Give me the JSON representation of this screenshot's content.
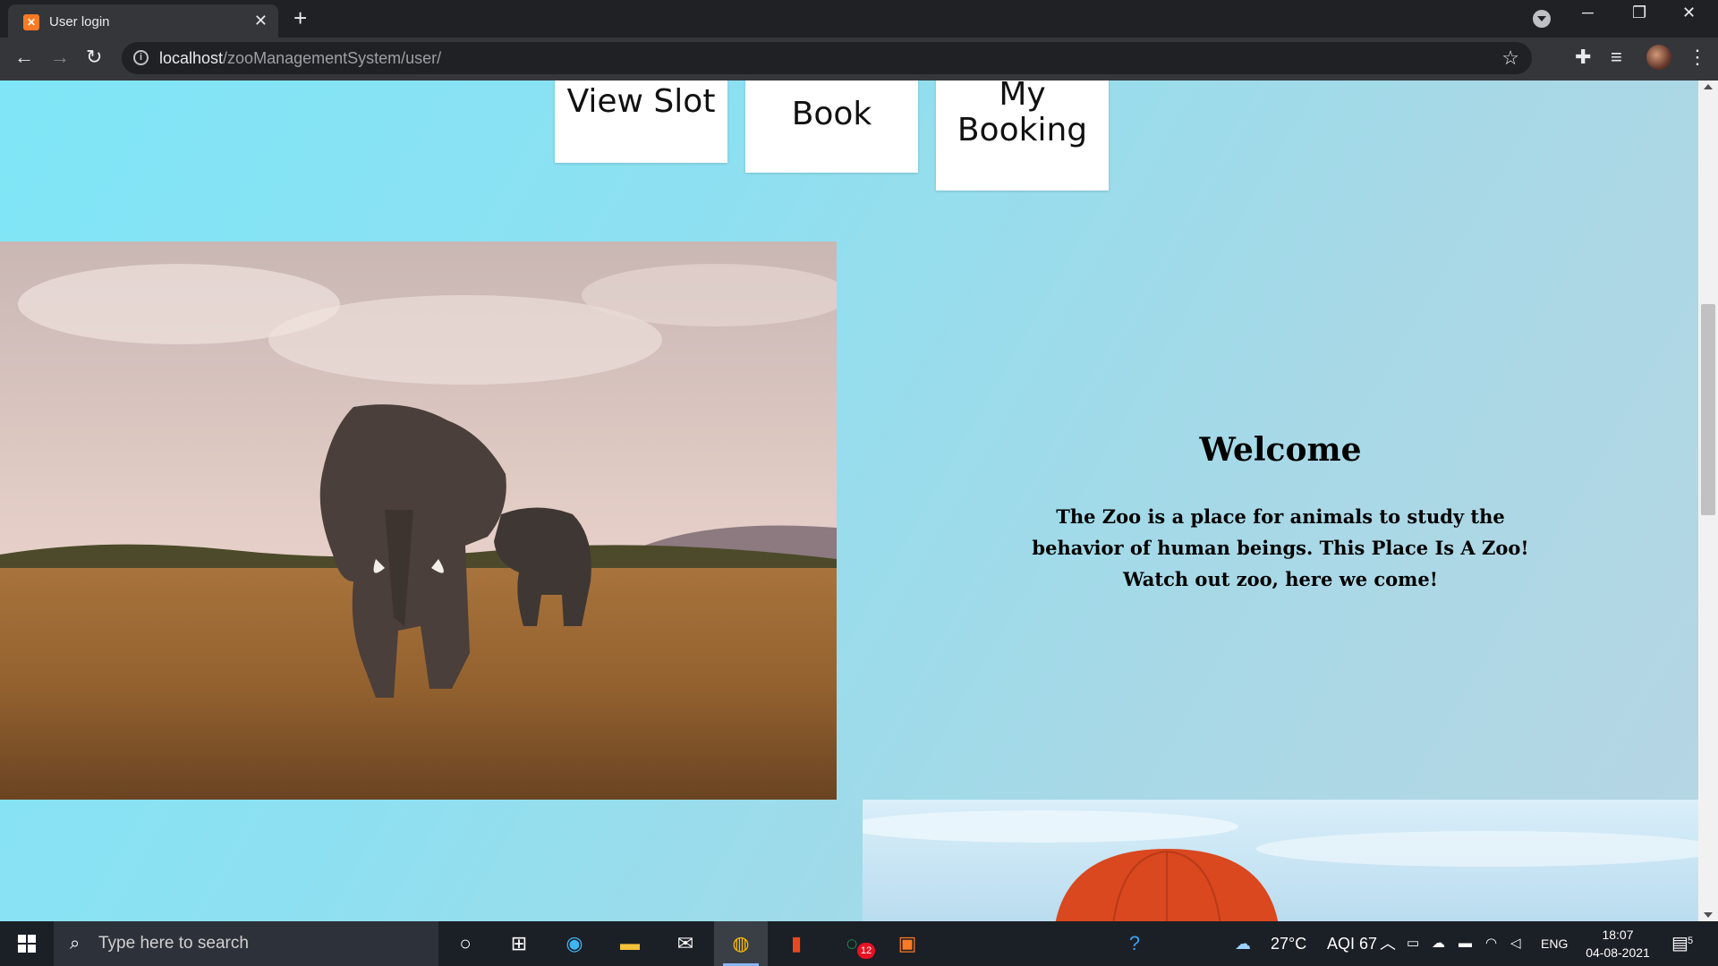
{
  "browser": {
    "tab_title": "User login",
    "tab_favicon_icon": "xampp-icon",
    "url_host": "localhost",
    "url_path": "/zooManagementSystem/user/"
  },
  "nav": {
    "view_slot": "View Slot",
    "book": "Book",
    "my_booking_line1": "My",
    "my_booking_line2": "Booking"
  },
  "welcome": {
    "title": "Welcome",
    "text": "The Zoo is a place for animals to study the behavior of human beings. This Place Is A Zoo! Watch out zoo, here we come!"
  },
  "taskbar": {
    "search_placeholder": "Type here to search",
    "whatsapp_badge": "12",
    "weather": "27°C",
    "aqi": "AQI 67",
    "language": "ENG",
    "time": "18:07",
    "date": "04-08-2021",
    "notification_count": "5"
  }
}
